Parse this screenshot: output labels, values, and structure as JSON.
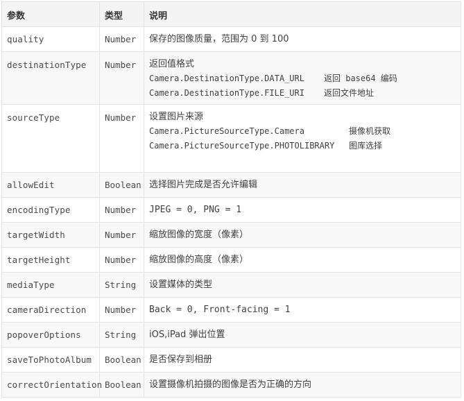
{
  "header": {
    "param": "参数",
    "type": "类型",
    "desc": "说明"
  },
  "rows": [
    {
      "name": "quality",
      "type": "Number",
      "desc": "保存的图像质量，范围为 0 到 100"
    },
    {
      "name": "destinationType",
      "type": "Number",
      "desc": "返回值格式",
      "options": [
        {
          "value": "Camera.DestinationType.DATA_URL",
          "meaning": "返回 base64 编码"
        },
        {
          "value": "Camera.DestinationType.FILE_URI",
          "meaning": "返回文件地址"
        }
      ]
    },
    {
      "name": "sourceType",
      "type": "Number",
      "desc": "设置图片来源",
      "options": [
        {
          "value": "Camera.PictureSourceType.Camera",
          "meaning": "摄像机获取"
        },
        {
          "value": "Camera.PictureSourceType.PHOTOLIBRARY",
          "meaning": "图库选择"
        }
      ]
    },
    {
      "name": "allowEdit",
      "type": "Boolean",
      "desc": "选择图片完成是否允许编辑"
    },
    {
      "name": "encodingType",
      "type": "Number",
      "desc": "JPEG = 0, PNG = 1"
    },
    {
      "name": "targetWidth",
      "type": "Number",
      "desc": "缩放图像的宽度（像素）"
    },
    {
      "name": "targetHeight",
      "type": "Number",
      "desc": "缩放图像的高度（像素）"
    },
    {
      "name": "mediaType",
      "type": "String",
      "desc": "设置媒体的类型"
    },
    {
      "name": "cameraDirection",
      "type": "Number",
      "desc": "Back = 0, Front-facing = 1"
    },
    {
      "name": "popoverOptions",
      "type": "String",
      "desc": "iOS,iPad 弹出位置"
    },
    {
      "name": "saveToPhotoAlbum",
      "type": "Boolean",
      "desc": "是否保存到相册"
    },
    {
      "name": "correctOrientation",
      "type": "Boolean",
      "desc": "设置摄像机拍摄的图像是否为正确的方向"
    }
  ]
}
